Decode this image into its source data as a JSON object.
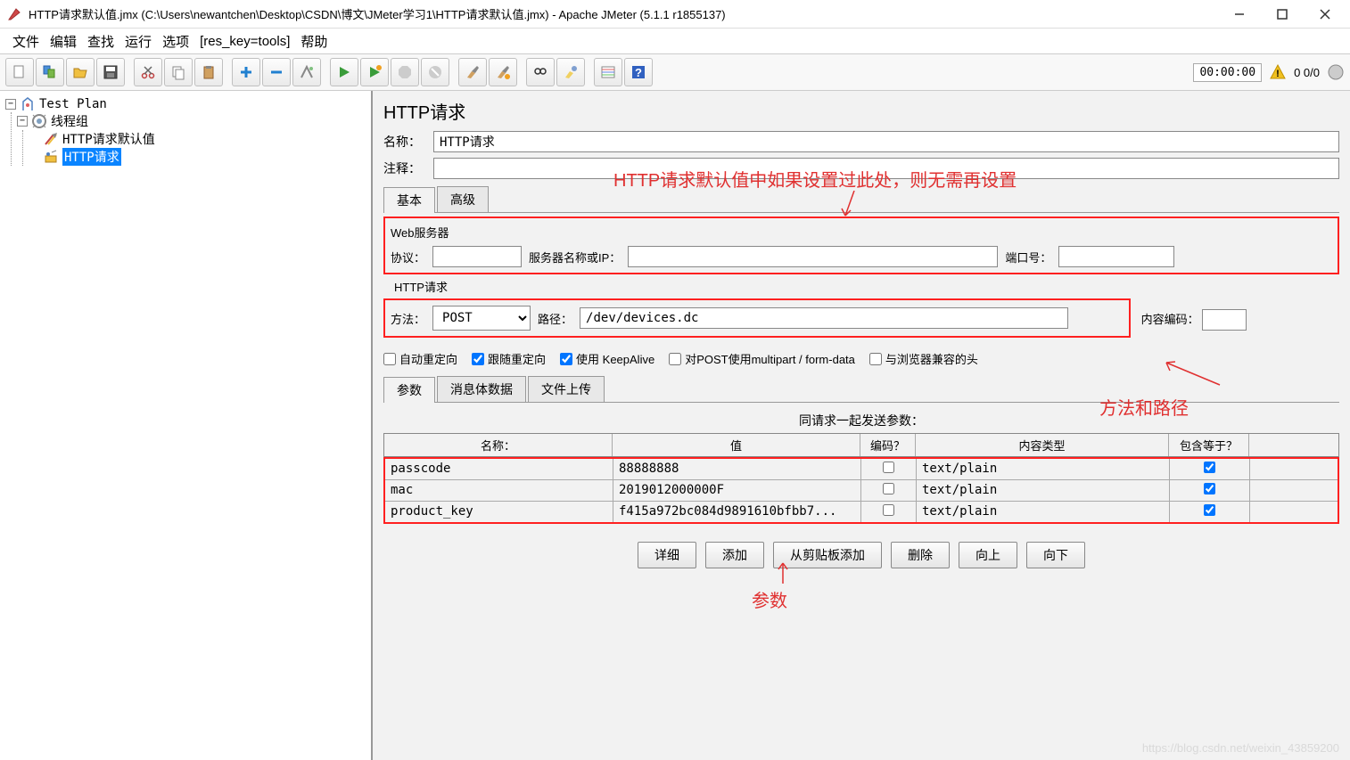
{
  "window": {
    "title": "HTTP请求默认值.jmx (C:\\Users\\newantchen\\Desktop\\CSDN\\博文\\JMeter学习1\\HTTP请求默认值.jmx) - Apache JMeter (5.1.1 r1855137)"
  },
  "menubar": [
    "文件",
    "编辑",
    "查找",
    "运行",
    "选项",
    "[res_key=tools]",
    "帮助"
  ],
  "toolbar_right": {
    "time": "00:00:00",
    "counts": "0  0/0"
  },
  "tree": {
    "root": "Test Plan",
    "thread_group": "线程组",
    "http_defaults": "HTTP请求默认值",
    "http_request": "HTTP请求"
  },
  "panel": {
    "title": "HTTP请求",
    "name_label": "名称：",
    "name_value": "HTTP请求",
    "comment_label": "注释：",
    "comment_value": "",
    "tabs": {
      "basic": "基本",
      "advanced": "高级"
    },
    "web_server": {
      "legend": "Web服务器",
      "protocol_label": "协议：",
      "protocol_value": "",
      "server_label": "服务器名称或IP：",
      "server_value": "",
      "port_label": "端口号：",
      "port_value": ""
    },
    "http_req": {
      "legend": "HTTP请求",
      "method_label": "方法：",
      "method_value": "POST",
      "path_label": "路径：",
      "path_value": "/dev/devices.dc",
      "encoding_label": "内容编码：",
      "encoding_value": ""
    },
    "checkboxes": {
      "auto_redirect": "自动重定向",
      "follow_redirect": "跟随重定向",
      "keepalive": "使用 KeepAlive",
      "multipart": "对POST使用multipart / form-data",
      "browser_compat": "与浏览器兼容的头"
    },
    "subtabs": {
      "params": "参数",
      "body": "消息体数据",
      "files": "文件上传"
    },
    "params_title": "同请求一起发送参数：",
    "param_headers": {
      "name": "名称：",
      "value": "值",
      "encode": "编码？",
      "content_type": "内容类型",
      "include_eq": "包含等于？"
    },
    "params": [
      {
        "name": "passcode",
        "value": "88888888",
        "encode": false,
        "content_type": "text/plain",
        "include_eq": true
      },
      {
        "name": "mac",
        "value": "2019012000000F",
        "encode": false,
        "content_type": "text/plain",
        "include_eq": true
      },
      {
        "name": "product_key",
        "value": "f415a972bc084d9891610bfbb7...",
        "encode": false,
        "content_type": "text/plain",
        "include_eq": true
      }
    ],
    "buttons": {
      "detail": "详细",
      "add": "添加",
      "paste": "从剪贴板添加",
      "delete": "删除",
      "up": "向上",
      "down": "向下"
    }
  },
  "annotations": {
    "defaults_hint": "HTTP请求默认值中如果设置过此处，则无需再设置",
    "method_path": "方法和路径",
    "params": "参数"
  },
  "watermark": "https://blog.csdn.net/weixin_43859200"
}
